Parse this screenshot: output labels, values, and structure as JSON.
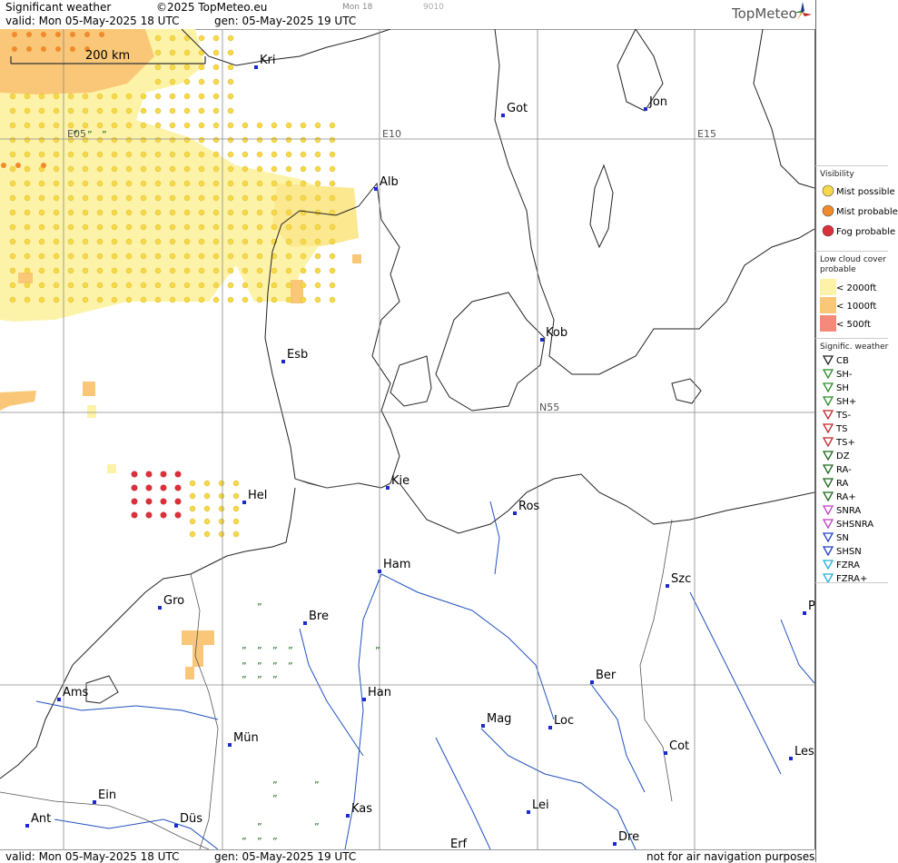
{
  "header": {
    "product": "Significant weather",
    "copyright": "©2025 TopMeteo.eu",
    "day_tag": "Mon 18",
    "code": "9010",
    "valid": "valid:  Mon  05-May-2025  18 UTC",
    "gen": "gen: 05-May-2025 19 UTC",
    "logo": "TopMeteo"
  },
  "footer": {
    "valid": "valid:  Mon  05-May-2025  18 UTC",
    "gen": "gen: 05-May-2025 19 UTC",
    "disclaimer": "not for air navigation purposes"
  },
  "scale": {
    "label": "200 km"
  },
  "grid_labels": [
    "E05",
    "E10",
    "E15",
    "N55"
  ],
  "cities": [
    {
      "name": "Kri"
    },
    {
      "name": "Got"
    },
    {
      "name": "Jon"
    },
    {
      "name": "Alb"
    },
    {
      "name": "Kob"
    },
    {
      "name": "Esb"
    },
    {
      "name": "Kie"
    },
    {
      "name": "Hel"
    },
    {
      "name": "Ros"
    },
    {
      "name": "Ham"
    },
    {
      "name": "Szc"
    },
    {
      "name": "Gro"
    },
    {
      "name": "Bre"
    },
    {
      "name": "P"
    },
    {
      "name": "Ber"
    },
    {
      "name": "Ams"
    },
    {
      "name": "Han"
    },
    {
      "name": "Mag"
    },
    {
      "name": "Loc"
    },
    {
      "name": "Mün"
    },
    {
      "name": "Cot"
    },
    {
      "name": "Les"
    },
    {
      "name": "Ein"
    },
    {
      "name": "Kas"
    },
    {
      "name": "Lei"
    },
    {
      "name": "Ant"
    },
    {
      "name": "Düs"
    },
    {
      "name": "Dre"
    },
    {
      "name": "Erf"
    }
  ],
  "legend": {
    "visibility": {
      "title": "Visibility",
      "items": [
        {
          "label": "Mist possible",
          "color": "#f5d94a"
        },
        {
          "label": "Mist probable",
          "color": "#f08a2a"
        },
        {
          "label": "Fog probable",
          "color": "#d9303a"
        }
      ]
    },
    "low_cloud": {
      "title": "Low cloud cover probable",
      "items": [
        {
          "label": "< 2000ft",
          "color": "#fdf3a8"
        },
        {
          "label": "< 1000ft",
          "color": "#f9c777"
        },
        {
          "label": "<   500ft",
          "color": "#f58a7a"
        }
      ]
    },
    "signific": {
      "title": "Signific. weather",
      "items": [
        {
          "label": "CB",
          "icon": "cb-icon",
          "color": "#222"
        },
        {
          "label": "SH-",
          "icon": "shower-light-icon",
          "color": "#2a8a2a"
        },
        {
          "label": "SH",
          "icon": "shower-icon",
          "color": "#2a8a2a"
        },
        {
          "label": "SH+",
          "icon": "shower-heavy-icon",
          "color": "#2a8a2a"
        },
        {
          "label": "TS-",
          "icon": "thunder-light-icon",
          "color": "#c0282a"
        },
        {
          "label": "TS",
          "icon": "thunder-icon",
          "color": "#c0282a"
        },
        {
          "label": "TS+",
          "icon": "thunder-heavy-icon",
          "color": "#c0282a"
        },
        {
          "label": "DZ",
          "icon": "drizzle-icon",
          "color": "#1a6a1a"
        },
        {
          "label": "RA-",
          "icon": "rain-light-icon",
          "color": "#1a6a1a"
        },
        {
          "label": "RA",
          "icon": "rain-icon",
          "color": "#1a6a1a"
        },
        {
          "label": "RA+",
          "icon": "rain-heavy-icon",
          "color": "#1a6a1a"
        },
        {
          "label": "SNRA",
          "icon": "snow-rain-icon",
          "color": "#c040c0"
        },
        {
          "label": "SHSNRA",
          "icon": "snow-rain-shower-icon",
          "color": "#c040c0"
        },
        {
          "label": "SN",
          "icon": "snow-icon",
          "color": "#2040c0"
        },
        {
          "label": "SHSN",
          "icon": "snow-shower-icon",
          "color": "#2040c0"
        },
        {
          "label": "FZRA",
          "icon": "freezing-rain-icon",
          "color": "#20b0d0"
        },
        {
          "label": "FZRA+",
          "icon": "freezing-rain-heavy-icon",
          "color": "#20b0d0"
        }
      ]
    }
  }
}
